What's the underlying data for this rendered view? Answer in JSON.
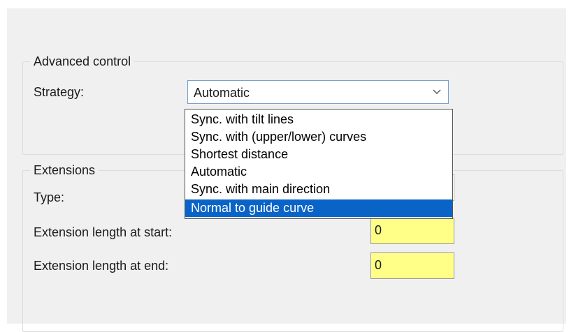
{
  "advanced_control": {
    "title": "Advanced control",
    "strategy_label": "Strategy:",
    "strategy_value": "Automatic",
    "strategy_options": [
      "Sync. with tilt lines",
      "Sync. with (upper/lower) curves",
      "Shortest distance",
      "Automatic",
      "Sync. with main direction",
      "Normal to guide curve"
    ],
    "highlighted_option": "Normal to guide curve"
  },
  "extensions": {
    "title": "Extensions",
    "type_label": "Type:",
    "start_label": "Extension length at start:",
    "start_value": "0",
    "end_label": "Extension length at end:",
    "end_value": "0"
  },
  "colors": {
    "panel_bg": "#f0f0f0",
    "selection": "#0a64c8",
    "required_field": "#ffff88"
  },
  "icons": {
    "combo_arrow": "chevron-down-icon"
  }
}
